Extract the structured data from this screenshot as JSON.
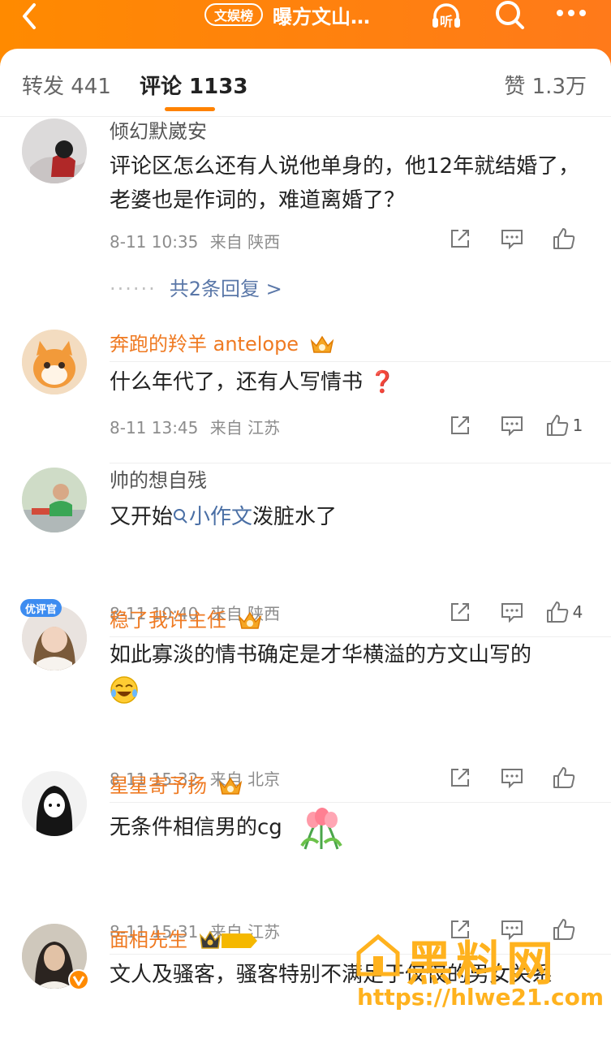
{
  "header": {
    "badge": "文娱榜",
    "title": "曝方文山…",
    "listen_label": "听"
  },
  "tabs": {
    "repost": "转发 441",
    "comments": "评论 1133",
    "likes": "赞 1.3万"
  },
  "comments": [
    {
      "name": "倾幻默崴安",
      "text": "评论区怎么还有人说他单身的，他12年就结婚了，老婆也是作词的，难道离婚了？",
      "time": "8-11 10:35",
      "location": "来自 陕西",
      "likes": "",
      "replies": "共2条回复 >"
    },
    {
      "name": "奔跑的羚羊 antelope",
      "text": "什么年代了，还有人写情书 ❓",
      "time": "8-11 13:45",
      "location": "来自 江苏",
      "likes": "1"
    },
    {
      "name": "帅的想自残",
      "text_before": "又开始",
      "topic": "小作文",
      "text_after": "泼脏水了",
      "time": "8-11 10:40",
      "location": "来自 陕西",
      "likes": "4"
    },
    {
      "name": "稳了我许主任",
      "avatar_badge": "优评官",
      "text": "如此寡淡的情书确定是才华横溢的方文山写的",
      "time": "8-11 15:32",
      "location": "来自 北京",
      "likes": ""
    },
    {
      "name": "星星寄予扬",
      "text": "无条件相信男的cg",
      "time": "8-11 15:31",
      "location": "来自 江苏",
      "likes": ""
    },
    {
      "name": "面相先生",
      "badge_level": "II",
      "text": "文人及骚客，骚客特别不满足于仅仅的男女关系"
    }
  ],
  "watermark": {
    "title": "黑料网",
    "url": "https://hlwe21.com"
  },
  "colors": {
    "accent": "#ff8200",
    "vip_name": "#ef7a22",
    "link": "#4a6fa5"
  }
}
